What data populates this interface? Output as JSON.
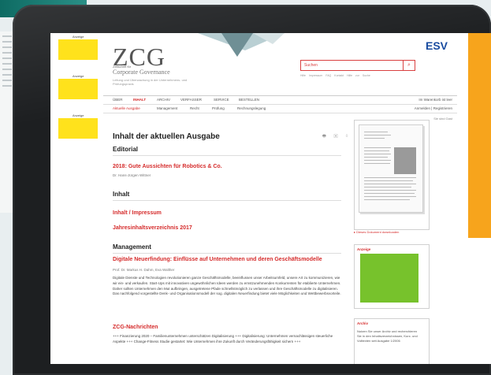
{
  "left_ads": {
    "label": "Anzeige"
  },
  "header": {
    "logo": "ZCG",
    "subtitle_small": "Zeitschrift für",
    "subtitle": "Corporate Governance",
    "tagline": "Leitung und Überwachung in der Unternehmens- und Prüfungspraxis",
    "publisher": "ESV",
    "search_placeholder": "Suchen",
    "search_links": "Hilfe  Impressum  FAQ  Kontakt      Hilfe zur Suche"
  },
  "nav": {
    "top": [
      "ÜBER",
      "INHALT",
      "ARCHIV",
      "VERFASSER",
      "SERVICE",
      "BESTELLEN"
    ],
    "top_active": "INHALT",
    "right_top": "Im Warenkorb ist leer",
    "sub": [
      "Aktuelle Ausgabe",
      "Management",
      "Recht",
      "Prüfung",
      "Rechnungslegung"
    ],
    "sub_active": "Aktuelle Ausgabe",
    "right_sub": "Anmelden | Registrieren",
    "right_sub2": "Sie sind Gast"
  },
  "content": {
    "title": "Inhalt der aktuellen Ausgabe",
    "tool_icons": "🖶 ✉ ⇩",
    "editorial_heading": "Editorial",
    "editorial_title": "2018: Gute Aussichten für Robotics & Co.",
    "editorial_author": "Dr. Hans-Jürgen Wittner",
    "inhalt_heading": "Inhalt",
    "inhalt_link1": "Inhalt / Impressum",
    "inhalt_link2": "Jahresinhaltsverzeichnis 2017",
    "management_heading": "Management",
    "article_title": "Digitale Neuerfindung: Einflüsse auf Unternehmen und deren Geschäftsmodelle",
    "article_author": "Prof. Dr. Markus H. Dahm, Eva Walther",
    "article_text": "Digitale Dienste und Technologien revolutionieren ganze Geschäftsmodelle, beeinflussen unser Arbeitsumfeld, unsere Art zu kommunizieren, wie wir ein- und verkaufen. Start-Ups mit innovativen ungewöhnlichen Ideen werden zu ernstzunehmenden Konkurrenten für etablierte Unternehmen. Daher sollten Unternehmen den Mut aufbringen, ausgetretene Pfade schnellstmöglich zu verlassen und ihre Geschäftsmodelle zu digitalisieren. Das nachfolgend vorgestellte Denk- und Organisationsmodell der sog. digitalen Neuerfindung bietet viele Möglichkeiten und Wettbewerbsvorteile.",
    "news_title": "ZCG-Nachrichten",
    "news_text": "+++ Finanzierung 2020 – Familienunternehmen unterschätzen Digitalisierung +++ Digitalisierung: Unternehmen vernachlässigen steuerliche Aspekte +++ Change-Fitness Studie gestartet: Wie Unternehmen ihre Zukunft durch Veränderungsfähigkeit sichern +++"
  },
  "sidebar": {
    "doc_link": "Dieses Dokument downloaden",
    "anzeige_label": "Anzeige",
    "archiv_title": "Archiv",
    "archiv_text": "Nutzen Sie unser Archiv und recherchieren Sie in den Inhaltsverzeichnissen, Kurz- und Volltexten seit Ausgabe 1/2006"
  },
  "colors": {
    "accent": "#d52b2b",
    "ad_yellow": "#ffe21c",
    "ad_orange": "#f7a41c",
    "ad_green": "#77c22c"
  }
}
